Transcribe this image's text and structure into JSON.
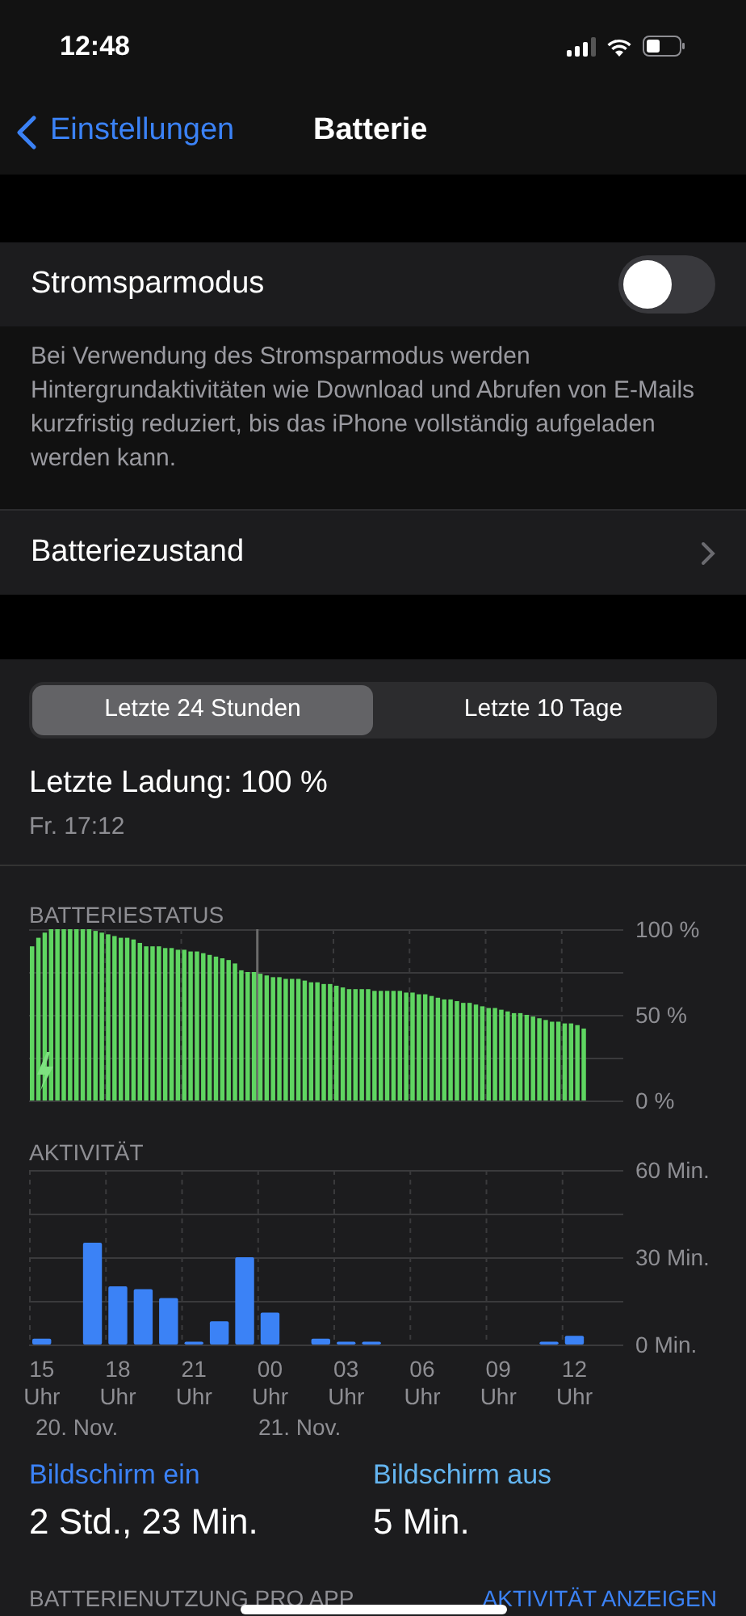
{
  "status_bar": {
    "time": "12:48"
  },
  "nav": {
    "back": "Einstellungen",
    "title": "Batterie"
  },
  "low_power": {
    "label": "Stromsparmodus",
    "on": false,
    "description": "Bei Verwendung des Stromsparmodus werden Hintergrundaktivitäten wie Download und Abrufen von E-Mails kurzfristig reduziert, bis das iPhone vollständig aufgeladen werden kann."
  },
  "battery_health": {
    "label": "Batteriezustand"
  },
  "segments": [
    {
      "label": "Letzte 24 Stunden",
      "selected": true
    },
    {
      "label": "Letzte 10 Tage",
      "selected": false
    }
  ],
  "last_charge": {
    "title": "Letzte Ladung: 100 %",
    "time": "Fr. 17:12"
  },
  "battery_status": {
    "heading": "BATTERIESTATUS",
    "chart_data": {
      "type": "bar",
      "grid": true,
      "ylim": [
        0,
        100
      ],
      "categories": [
        null,
        null,
        null,
        null,
        null,
        null,
        null,
        null,
        null,
        null,
        null,
        null,
        null,
        null,
        null,
        null,
        null,
        null,
        null,
        null,
        null,
        null,
        null,
        null,
        null,
        null,
        null,
        null,
        null,
        null,
        null,
        null,
        null,
        null,
        null,
        null,
        null,
        null,
        null,
        null,
        null,
        null,
        null,
        null,
        null,
        null,
        null,
        null,
        null,
        null,
        null,
        null,
        null,
        null,
        null,
        null,
        null,
        null,
        null,
        null,
        null,
        null,
        null,
        null,
        null,
        null,
        null,
        null,
        null,
        null,
        null,
        null,
        null,
        null,
        null,
        null,
        null,
        null,
        null,
        null,
        null,
        null,
        null,
        null,
        null,
        null,
        null,
        null,
        null,
        null,
        null,
        null,
        null,
        null,
        null,
        null
      ],
      "yticks": [
        {
          "value": 100,
          "label": "100 %"
        },
        {
          "value": 50,
          "label": "50 %"
        },
        {
          "value": 0,
          "label": "0 %"
        }
      ],
      "values": [
        90,
        95,
        98,
        100,
        100,
        100,
        100,
        100,
        100,
        100,
        99,
        98,
        97,
        96,
        95,
        95,
        94,
        92,
        90,
        90,
        90,
        89,
        89,
        88,
        88,
        87,
        87,
        86,
        85,
        84,
        83,
        82,
        80,
        76,
        75,
        75,
        74,
        73,
        72,
        72,
        71,
        71,
        71,
        70,
        69,
        69,
        68,
        68,
        67,
        66,
        65,
        65,
        65,
        65,
        64,
        64,
        64,
        64,
        64,
        63,
        63,
        62,
        62,
        61,
        60,
        59,
        59,
        58,
        57,
        57,
        56,
        55,
        54,
        54,
        53,
        52,
        51,
        51,
        50,
        49,
        48,
        47,
        46,
        46,
        45,
        45,
        44,
        42,
        null,
        null,
        null,
        null,
        null,
        null,
        null,
        null
      ]
    }
  },
  "activity": {
    "heading": "AKTIVITÄT",
    "chart_data": {
      "type": "bar",
      "grid": true,
      "ylim": [
        0,
        60
      ],
      "yticks": [
        {
          "value": 60,
          "label": "60 Min."
        },
        {
          "value": 30,
          "label": "30 Min."
        },
        {
          "value": 0,
          "label": "0 Min."
        }
      ],
      "categories": [
        "15 Uhr",
        null,
        null,
        "18 Uhr",
        null,
        null,
        "21 Uhr",
        null,
        null,
        "00 Uhr",
        null,
        null,
        "03 Uhr",
        null,
        null,
        "06 Uhr",
        null,
        null,
        "09 Uhr",
        null,
        null,
        "12 Uhr",
        null,
        null
      ],
      "values": [
        2,
        0,
        35,
        20,
        19,
        16,
        1,
        8,
        30,
        11,
        0,
        2,
        1,
        1,
        0,
        0,
        0,
        0,
        0,
        0,
        1,
        3,
        0,
        0
      ]
    },
    "date_labels": [
      "20. Nov.",
      "21. Nov."
    ]
  },
  "screen_stats": [
    {
      "label": "Bildschirm ein",
      "value": "2 Std., 23 Min.",
      "color": "#3b82f6"
    },
    {
      "label": "Bildschirm aus",
      "value": "5 Min.",
      "color": "#64b5f0"
    }
  ],
  "usage": {
    "heading": "BATTERIENUTZUNG PRO APP",
    "link": "AKTIVITÄT ANZEIGEN"
  }
}
